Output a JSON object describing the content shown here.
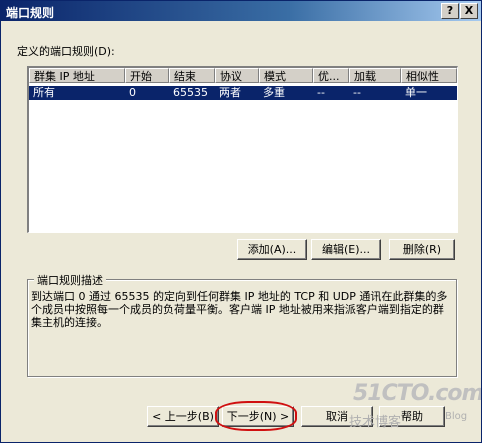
{
  "window": {
    "title": "端口规则",
    "help_btn": "?",
    "close_btn": "X"
  },
  "rules_label": "定义的端口规则(D):",
  "list": {
    "columns": [
      "群集 IP 地址",
      "开始",
      "结束",
      "协议",
      "模式",
      "优...",
      "加载",
      "相似性"
    ],
    "rows": [
      [
        "所有",
        "0",
        "65535",
        "两者",
        "多重",
        "--",
        "--",
        "单一"
      ]
    ],
    "selected_row": 0
  },
  "buttons": {
    "add": "添加(A)...",
    "edit": "编辑(E)...",
    "delete": "删除(R)"
  },
  "description": {
    "legend": "端口规则描述",
    "text": "到达端口 0 通过 65535 的定向到任何群集 IP 地址的 TCP 和 UDP 通讯在此群集的多个成员中按照每一个成员的负荷量平衡。客户端 IP 地址被用来指派客户端到指定的群集主机的连接。"
  },
  "nav": {
    "back": "< 上一步(B)",
    "next": "下一步(N) >",
    "cancel": "取消",
    "help": "帮助"
  },
  "watermark": {
    "logo": "51CTO.com",
    "subtitle": "技术博客",
    "blog": "Blog"
  },
  "colors": {
    "title_bar": "#0a246a",
    "selection": "#0a246a",
    "highlight_oval": "#d01010",
    "face": "#ece9d8"
  }
}
